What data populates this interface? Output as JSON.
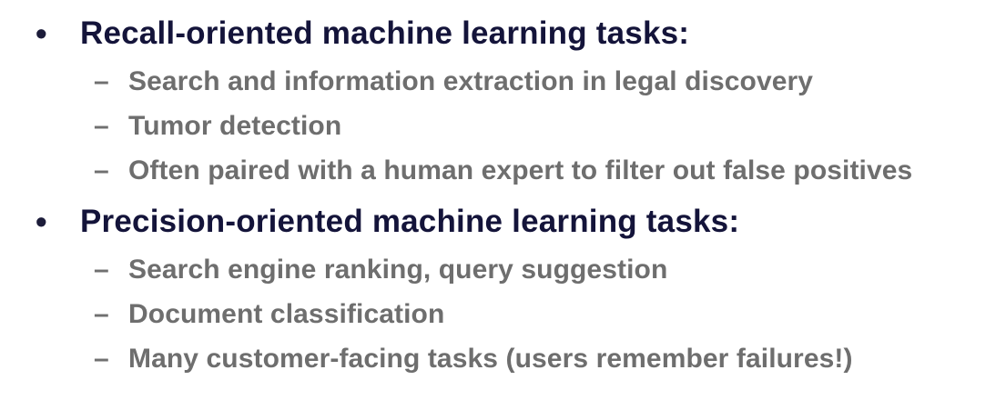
{
  "slide": {
    "bullet_marker": "•",
    "dash_marker": "–",
    "sections": [
      {
        "heading": "Recall-oriented machine learning tasks:",
        "items": [
          "Search and information extraction in legal discovery",
          "Tumor detection",
          "Often paired with a human expert to filter out false positives"
        ]
      },
      {
        "heading": "Precision-oriented machine learning tasks:",
        "items": [
          "Search engine ranking, query suggestion",
          "Document classification",
          "Many customer-facing tasks (users remember failures!)"
        ]
      }
    ]
  }
}
